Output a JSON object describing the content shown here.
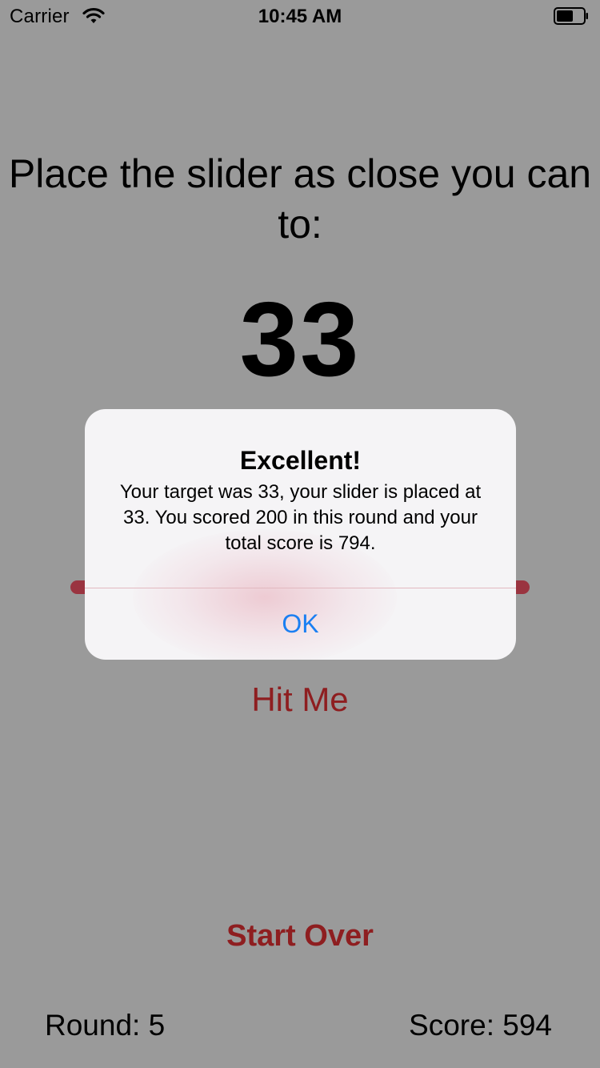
{
  "status_bar": {
    "carrier": "Carrier",
    "time": "10:45 AM",
    "wifi_icon": "wifi-icon",
    "battery_icon": "battery-icon"
  },
  "game": {
    "instruction": "Place the slider as close you can to:",
    "target": "33",
    "slider_value": 33,
    "hit_me_label": "Hit Me",
    "start_over_label": "Start Over",
    "round_text": "Round: 5",
    "score_text": "Score: 594"
  },
  "alert": {
    "title": "Excellent!",
    "message": "Your target was 33, your slider is placed at 33. You scored 200 in this round and your total score is 794.",
    "ok_label": "OK"
  },
  "colors": {
    "background_dim": "#9a9a9a",
    "accent_red": "#8e1e20",
    "slider_track": "#9a3440",
    "alert_button_blue": "#1a7ff2"
  }
}
